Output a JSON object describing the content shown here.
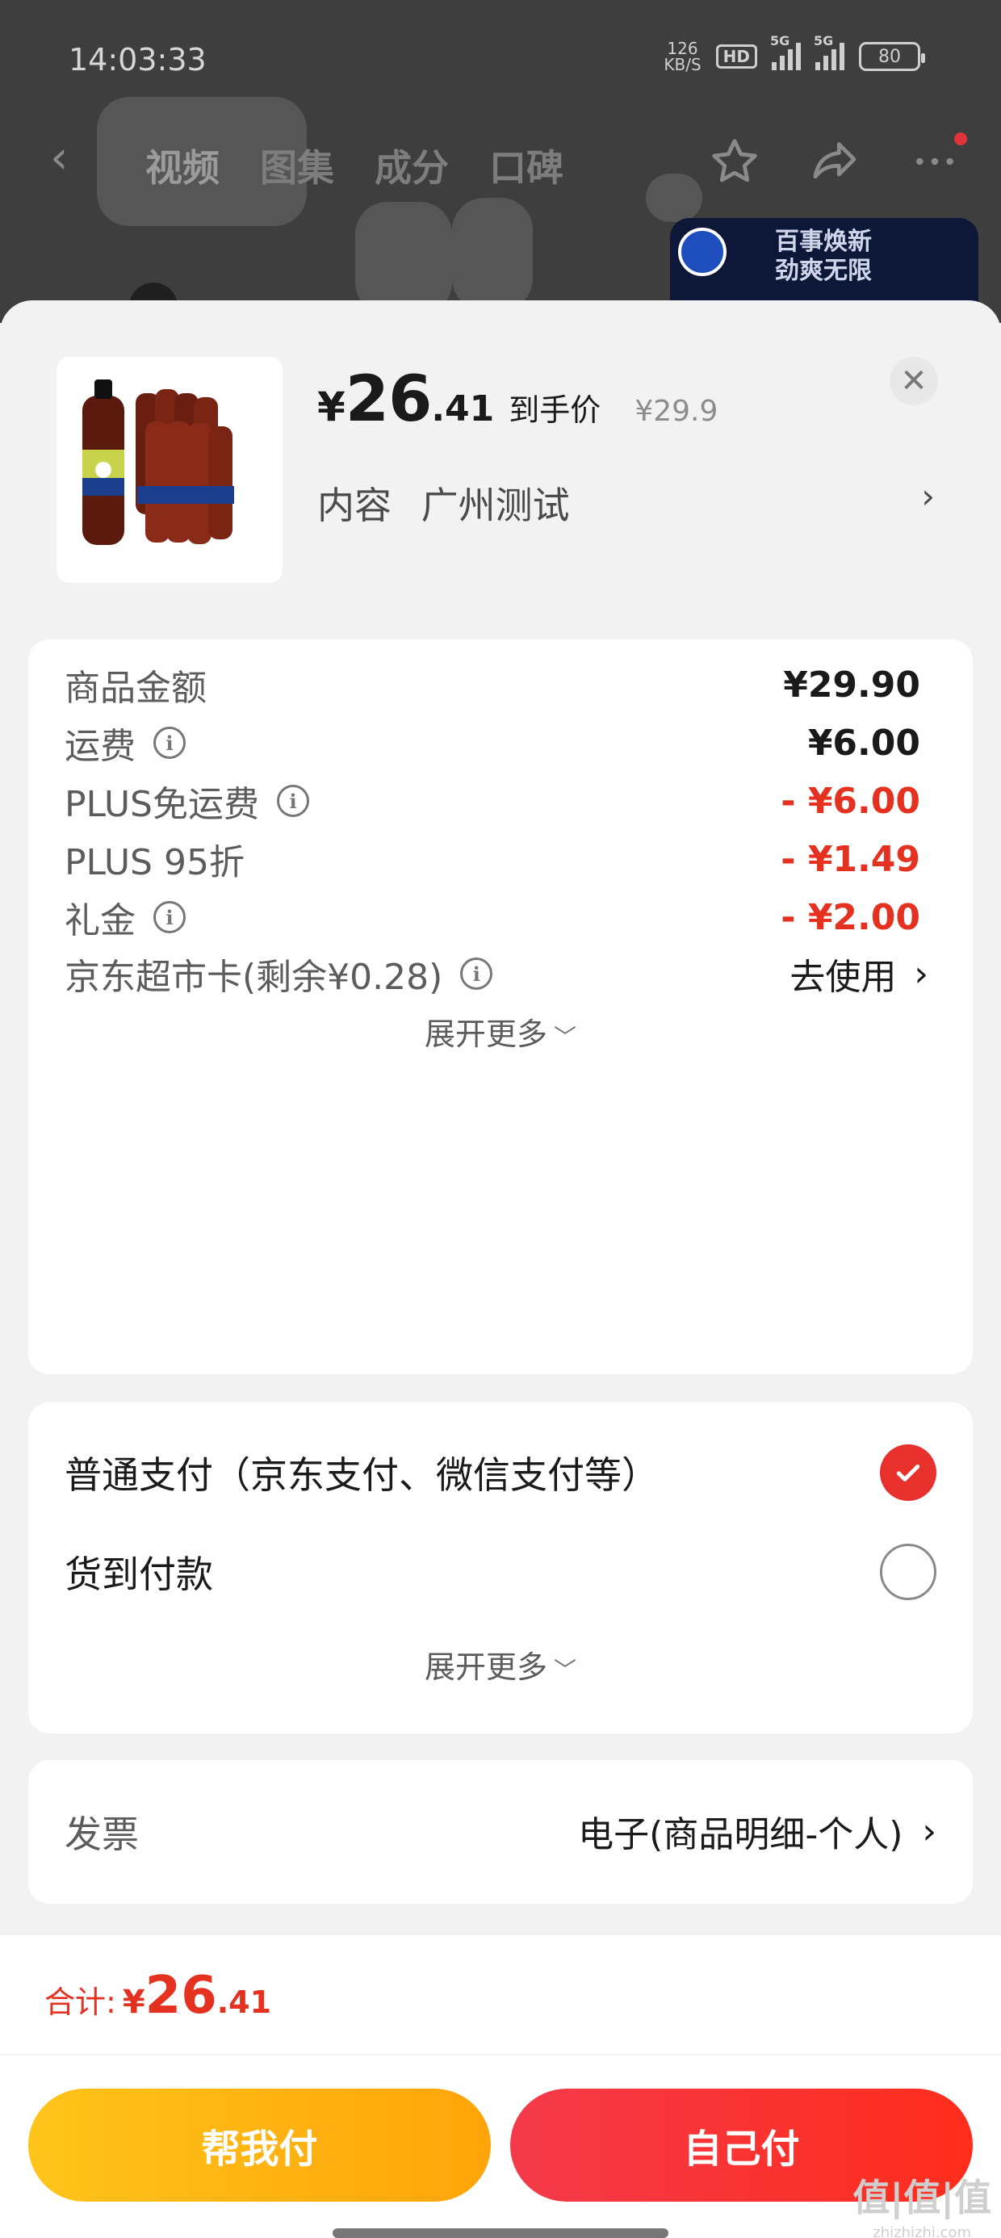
{
  "status_bar": {
    "time": "14:03:33",
    "net_speed_value": "126",
    "net_speed_unit": "KB/S",
    "hd": "HD",
    "signal_tag": "5G",
    "battery": "80"
  },
  "top_nav": {
    "tabs": [
      "视频",
      "图集",
      "成分",
      "口碑"
    ]
  },
  "ad": {
    "line1": "百事焕新",
    "line2": "劲爽无限",
    "logo": "PEPSI"
  },
  "product": {
    "price_currency": "¥",
    "price_int": "26",
    "price_dec": ".41",
    "price_tag": "到手价",
    "original_price": "¥29.9",
    "content_label": "内容",
    "content_value": "广州测试"
  },
  "fees": [
    {
      "label": "商品金额",
      "info": false,
      "value": "¥29.90",
      "red": false
    },
    {
      "label": "运费",
      "info": true,
      "value": "¥6.00",
      "red": false
    },
    {
      "label": "PLUS免运费",
      "info": true,
      "value": "- ¥6.00",
      "red": true
    },
    {
      "label": "PLUS 95折",
      "info": false,
      "value": "- ¥1.49",
      "red": true
    },
    {
      "label": "礼金",
      "info": true,
      "value": "- ¥2.00",
      "red": true
    }
  ],
  "card_row": {
    "label": "京东超市卡(剩余¥0.28)",
    "action": "去使用"
  },
  "expand_more": "展开更多",
  "payment": {
    "options": [
      {
        "label": "普通支付（京东支付、微信支付等）",
        "selected": true
      },
      {
        "label": "货到付款",
        "selected": false
      }
    ],
    "expand_more": "展开更多"
  },
  "invoice": {
    "label": "发票",
    "value": "电子(商品明细-个人)"
  },
  "footer": {
    "total_label": "合计:",
    "total_currency": "¥",
    "total_int": "26",
    "total_dec": ".41",
    "help_pay": "帮我付",
    "self_pay": "自己付"
  },
  "watermark": {
    "main": "值|值|值",
    "sub": "zhizhizhi.com"
  },
  "colors": {
    "accent_red": "#e5311f",
    "yellow_button": "#ffb411",
    "red_button": "#f43a3a"
  }
}
